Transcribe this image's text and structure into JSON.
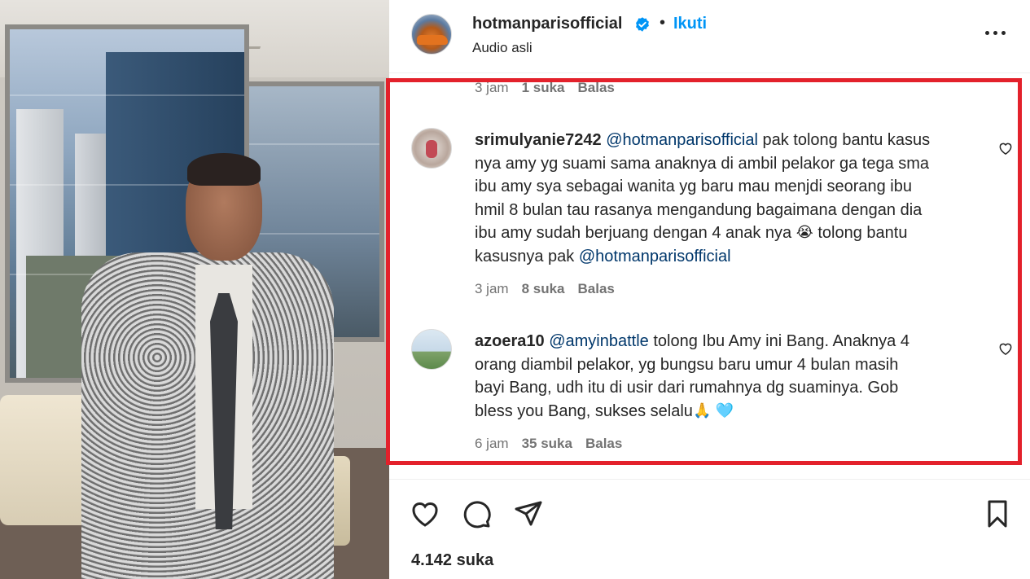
{
  "post": {
    "author": "hotmanparisofficial",
    "follow_label": "Ikuti",
    "separator": "•",
    "audio": "Audio asli",
    "likes_count": "4.142 suka"
  },
  "prev_comment": {
    "time": "3 jam",
    "likes": "1 suka",
    "reply": "Balas"
  },
  "comments": [
    {
      "username": "srimulyanie7242",
      "mention": "@hotmanparisofficial",
      "lines": [
        " pak tolong bantu kasus",
        "nya amy yg suami sama anaknya di ambil pelakor ga tega sma",
        "ibu amy sya sebagai wanita yg baru mau menjdi seorang ibu",
        "hmil 8 bulan tau rasanya mengandung bagaimana dengan dia",
        "ibu amy sudah berjuang dengan 4 anak nya ",
        " tolong bantu",
        "kasusnya pak "
      ],
      "end_mention": "@hotmanparisofficial",
      "emoji": "😭",
      "time": "3 jam",
      "likes": "8 suka",
      "reply": "Balas"
    },
    {
      "username": "azoera10",
      "mention": "@amyinbattle",
      "lines": [
        " tolong Ibu Amy ini Bang. Anaknya 4",
        "orang diambil pelakor, yg bungsu baru umur 4 bulan masih",
        "bayi Bang, udh itu di usir dari rumahnya dg suaminya. Gob",
        "bless you Bang, sukses selalu"
      ],
      "emoji_1": "🙏",
      "emoji_2": "🩵",
      "time": "6 jam",
      "likes": "35 suka",
      "reply": "Balas"
    }
  ],
  "colors": {
    "accent": "#0095f6",
    "mention": "#00376b",
    "highlight": "#e3212b",
    "muted": "#737373"
  },
  "icons": [
    "verified-badge-icon",
    "more-options-icon",
    "heart-icon",
    "comment-icon",
    "share-icon",
    "bookmark-icon"
  ]
}
